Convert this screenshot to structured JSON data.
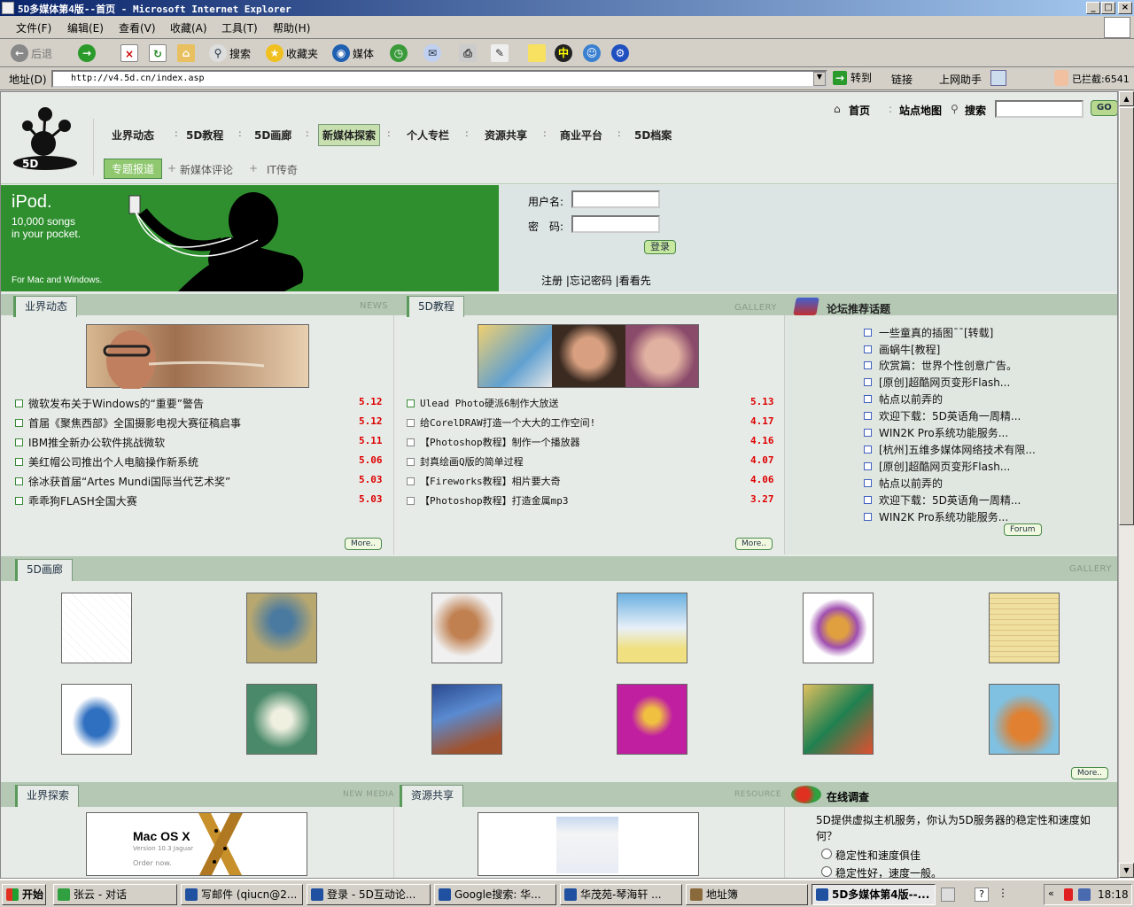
{
  "window": {
    "title": "5D多媒体第4版--首页 - Microsoft Internet Explorer"
  },
  "menu": [
    "文件(F)",
    "编辑(E)",
    "查看(V)",
    "收藏(A)",
    "工具(T)",
    "帮助(H)"
  ],
  "toolbar": {
    "back": "后退",
    "search": "搜索",
    "favorites": "收藏夹",
    "media": "媒体"
  },
  "address": {
    "label": "地址(D)",
    "url": "http://v4.5d.cn/index.asp",
    "go": "转到",
    "links": "链接",
    "assistant": "上网助手",
    "blocked": "已拦截:6541"
  },
  "topbar": {
    "home": "首页",
    "sitemap": "站点地图",
    "search": "搜索",
    "go": "GO"
  },
  "nav": [
    "业界动态",
    "5D教程",
    "5D画廊",
    "新媒体探索",
    "个人专栏",
    "资源共享",
    "商业平台",
    "5D档案"
  ],
  "subnav": [
    "专题报道",
    "新媒体评论",
    "IT传奇"
  ],
  "banner": {
    "brand": "iPod.",
    "line1": "10,000 songs",
    "line2": "in your pocket.",
    "foot": "For Mac and Windows."
  },
  "login": {
    "user_label": "用户名:",
    "pass_label": "密　码:",
    "login_btn": "登录",
    "links": "注册 |忘记密码 |看看先"
  },
  "news": {
    "tab": "业界动态",
    "label": "NEWS",
    "items": [
      {
        "title": "微软发布关于Windows的“重要”警告",
        "date": "5.12"
      },
      {
        "title": "首届《聚焦西部》全国摄影电视大赛征稿启事",
        "date": "5.12"
      },
      {
        "title": "IBM推全新办公软件挑战微软",
        "date": "5.11"
      },
      {
        "title": "美红帽公司推出个人电脑操作新系统",
        "date": "5.06"
      },
      {
        "title": "徐冰获首届“Artes Mundi国际当代艺术奖”",
        "date": "5.03"
      },
      {
        "title": "乖乖狗FLASH全国大赛",
        "date": "5.03"
      }
    ],
    "more": "More.."
  },
  "tutorials": {
    "tab": "5D教程",
    "label": "GALLERY",
    "items": [
      {
        "title": "Ulead Photo硬派6制作大放送",
        "date": "5.13"
      },
      {
        "title": "给CorelDRAW打造一个大大的工作空间!",
        "date": "4.17"
      },
      {
        "title": "【Photoshop教程】制作一个播放器",
        "date": "4.16"
      },
      {
        "title": "封真绘画Q版的简单过程",
        "date": "4.07"
      },
      {
        "title": "【Fireworks教程】相片要大奇",
        "date": "4.06"
      },
      {
        "title": "【Photoshop教程】打造金属mp3",
        "date": "3.27"
      }
    ],
    "more": "More.."
  },
  "forum": {
    "title": "论坛推荐话题",
    "items": [
      "一些童真的插图¯¯[转载]",
      "画蜗牛[教程]",
      "欣赏篇：世界个性创意广告。",
      "[原创]超酷网页变形Flash...",
      "帖点以前弄的",
      "欢迎下载：5D英语角一周精...",
      "WIN2K Pro系统功能服务...",
      "[杭州]五维多媒体网络技术有限...",
      "[原创]超酷网页变形Flash...",
      "帖点以前弄的",
      "欢迎下载：5D英语角一周精...",
      "WIN2K Pro系统功能服务..."
    ],
    "more": "Forum"
  },
  "gallery": {
    "tab": "5D画廊",
    "label": "GALLERY",
    "more": "More.."
  },
  "bottom": {
    "explore_tab": "业界探索",
    "explore_label": "NEW MEDIA",
    "resource_tab": "资源共享",
    "resource_label": "RESOURCE",
    "survey_title": "在线调查",
    "survey_question": "5D提供虚拟主机服务，你认为5D服务器的稳定性和速度如何？",
    "survey_opt1": "稳定性和速度俱佳",
    "survey_opt2": "稳定性好，速度一般。",
    "mac_title": "Mac OS X",
    "mac_sub": "Version 10.3 Jaguar",
    "mac_order": "Order now."
  },
  "taskbar": {
    "start": "开始",
    "tasks": [
      "张云 - 对话",
      "写邮件 (qiucn@2...",
      "登录 - 5D互动论...",
      "Google搜索: 华...",
      "华茂苑-琴海轩 ...",
      "地址簿",
      "5D多媒体第4版--..."
    ],
    "clock": "18:18"
  },
  "colors": {
    "green": "#2f8f2f",
    "nav_bg": "#e7ebe7",
    "panel": "#b4c8b4",
    "date_red": "#dd0000"
  }
}
